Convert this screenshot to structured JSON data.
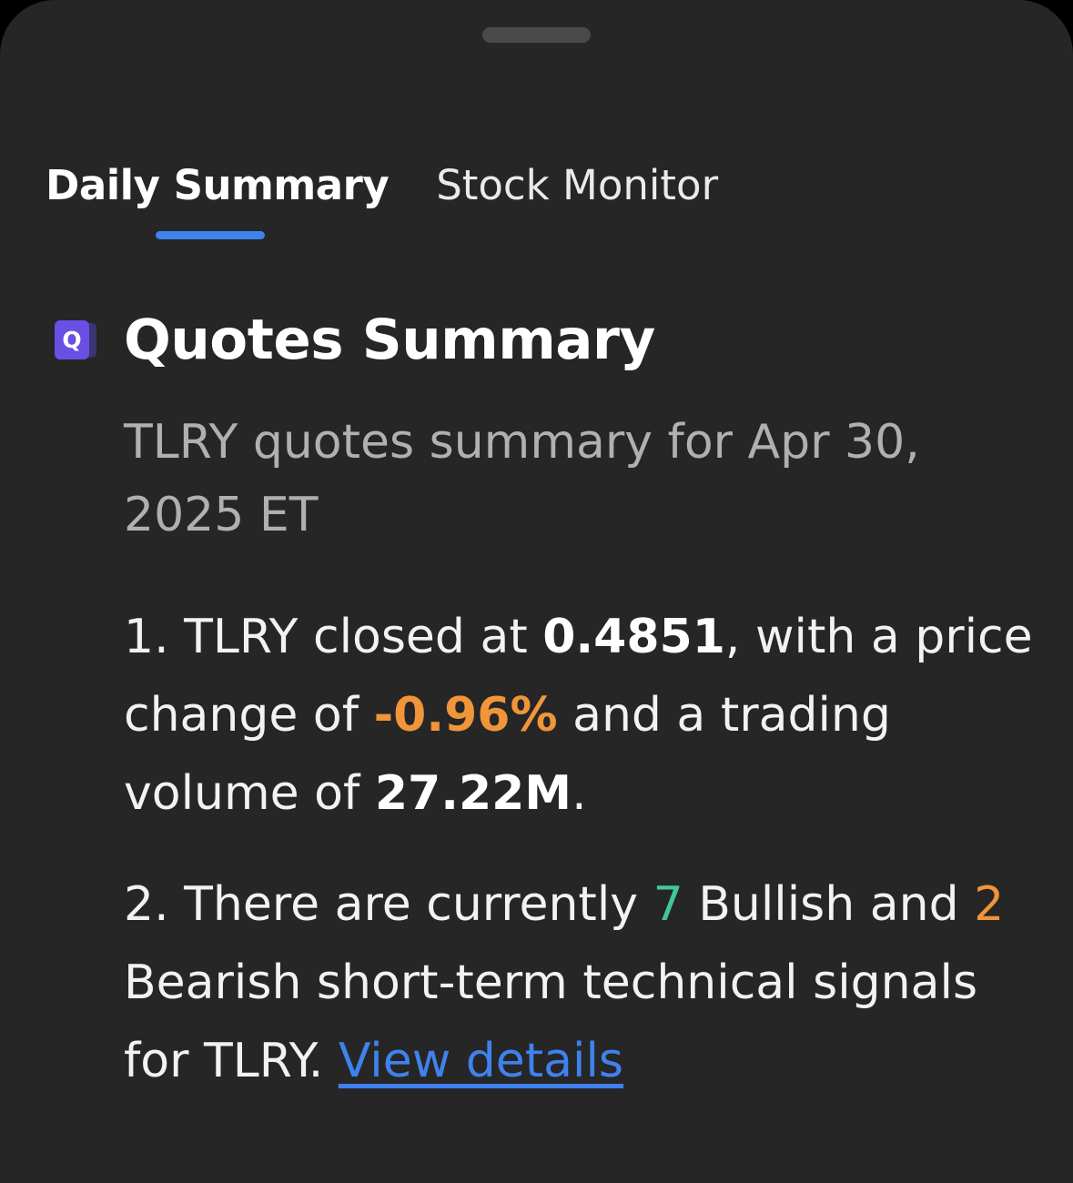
{
  "tabs": [
    {
      "label": "Daily Summary",
      "active": true
    },
    {
      "label": "Stock Monitor",
      "active": false
    }
  ],
  "section": {
    "icon_letter": "Q",
    "icon_name": "quotes-summary-icon",
    "title": "Quotes Summary"
  },
  "summary": {
    "subtitle": "TLRY quotes summary for Apr 30, 2025 ET",
    "item1": {
      "t1": "1. TLRY closed at ",
      "close_price": "0.4851",
      "t2": ", with a price change of ",
      "price_change": "-0.96%",
      "t3": " and a trading volume of ",
      "volume": "27.22M",
      "t4": "."
    },
    "item2": {
      "t1": "2. There are currently ",
      "bullish_count": "7",
      "t2": " Bullish and ",
      "bearish_count": "2",
      "t3": " Bearish short-term technical signals for TLRY. ",
      "link_label": "View details"
    }
  },
  "colors": {
    "background": "#262626",
    "accent": "#3f82ee",
    "negative": "#f0953a",
    "positive": "#42c79a",
    "icon": "#6a4fe4"
  }
}
